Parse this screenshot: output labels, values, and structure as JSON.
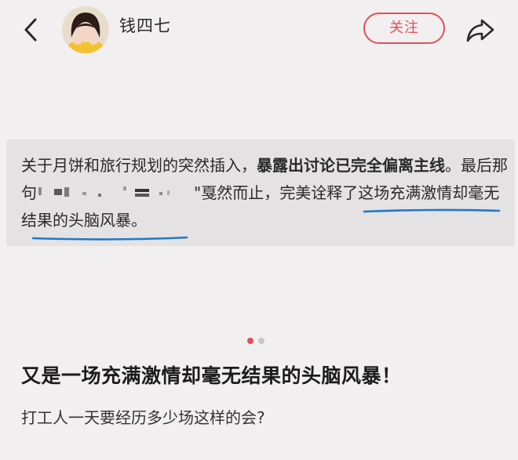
{
  "header": {
    "back_icon": "chevron-left-icon",
    "username": "钱四七",
    "follow_label": "关注",
    "share_icon": "share-arrow-icon"
  },
  "colors": {
    "background": "#f1eff0",
    "accent": "#e0505a",
    "underline": "#1f78c8",
    "quote_bg": "#e4e2e3"
  },
  "quote": {
    "line1_normal": "关于月饼和旅行规划的突然插入，",
    "line1_strong": "暴露出讨论已完全偏离主",
    "line2_strong": "线",
    "line2_text_a": "。最后那句",
    "line2_text_b": "\"戛然而止，完美诠释了这场",
    "line3_text": "充满激情却毫无结果的头脑风暴。"
  },
  "pager": {
    "total": 2,
    "active_index": 0
  },
  "post": {
    "title": "又是一场充满激情却毫无结果的头脑风暴！",
    "body": "打工人一天要经历多少场这样的会?"
  }
}
